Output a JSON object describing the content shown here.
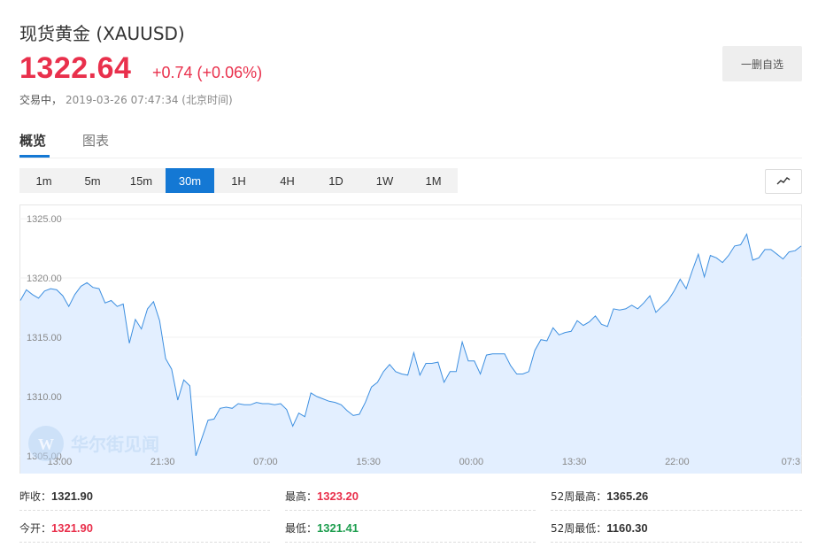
{
  "header": {
    "title": "现货黄金",
    "symbol": "(XAUUSD)",
    "price": "1322.64",
    "change": "+0.74 (+0.06%)",
    "status": "交易中，",
    "timestamp": "2019-03-26 07:47:34 (北京时间)",
    "watch_button": "一删自选"
  },
  "tabs": [
    {
      "label": "概览",
      "active": true
    },
    {
      "label": "图表",
      "active": false
    }
  ],
  "periods": [
    {
      "label": "1m"
    },
    {
      "label": "5m"
    },
    {
      "label": "15m"
    },
    {
      "label": "30m",
      "active": true
    },
    {
      "label": "1H"
    },
    {
      "label": "4H"
    },
    {
      "label": "1D"
    },
    {
      "label": "1W"
    },
    {
      "label": "1M"
    }
  ],
  "chart_type_icon": "line-chart-icon",
  "watermark": "华尔街见闻",
  "colors": {
    "up": "#e9304c",
    "down": "#1e9e4f",
    "accent": "#1478d4",
    "line": "#3d8fe0",
    "area": "#e3efff"
  },
  "chart_data": {
    "type": "area",
    "ylim": [
      1303.5,
      1326.2
    ],
    "yticks": [
      "1325.00",
      "1320.00",
      "1315.00",
      "1310.00",
      "1305.00"
    ],
    "ytick_values": [
      1325,
      1320,
      1315,
      1310,
      1305
    ],
    "xtick_labels": [
      "13:00",
      "21:30",
      "07:00",
      "15:30",
      "00:00",
      "13:30",
      "22:00",
      "07:3"
    ],
    "xtick_index": [
      6.5,
      23.5,
      40.5,
      57.5,
      74.5,
      91.5,
      108.5,
      125.5
    ],
    "values": [
      1318.1,
      1319.0,
      1318.6,
      1318.3,
      1318.9,
      1319.1,
      1319.0,
      1318.5,
      1317.6,
      1318.6,
      1319.3,
      1319.6,
      1319.2,
      1319.1,
      1317.9,
      1318.1,
      1317.6,
      1317.8,
      1314.5,
      1316.5,
      1315.7,
      1317.4,
      1318.0,
      1316.4,
      1313.2,
      1312.3,
      1309.7,
      1311.4,
      1310.9,
      1305.0,
      1306.5,
      1308.0,
      1308.1,
      1309.0,
      1309.1,
      1309.0,
      1309.4,
      1309.3,
      1309.3,
      1309.5,
      1309.4,
      1309.4,
      1309.3,
      1309.4,
      1308.9,
      1307.5,
      1308.6,
      1308.3,
      1310.3,
      1310.0,
      1309.8,
      1309.6,
      1309.5,
      1309.3,
      1308.8,
      1308.4,
      1308.5,
      1309.5,
      1310.8,
      1311.2,
      1312.1,
      1312.7,
      1312.1,
      1311.9,
      1311.8,
      1313.7,
      1311.8,
      1312.8,
      1312.8,
      1312.9,
      1311.2,
      1312.1,
      1312.1,
      1314.6,
      1313.0,
      1313.0,
      1311.9,
      1313.5,
      1313.6,
      1313.6,
      1313.6,
      1312.6,
      1311.9,
      1311.9,
      1312.1,
      1313.9,
      1314.8,
      1314.7,
      1315.8,
      1315.2,
      1315.4,
      1315.5,
      1316.4,
      1316.0,
      1316.3,
      1316.8,
      1316.1,
      1315.9,
      1317.4,
      1317.3,
      1317.4,
      1317.7,
      1317.4,
      1317.9,
      1318.5,
      1317.1,
      1317.6,
      1318.1,
      1318.9,
      1319.9,
      1319.1,
      1320.6,
      1322.0,
      1320.1,
      1321.9,
      1321.7,
      1321.3,
      1321.9,
      1322.7,
      1322.8,
      1323.7,
      1321.5,
      1321.7,
      1322.4,
      1322.4,
      1322.0,
      1321.6,
      1322.2,
      1322.3,
      1322.7
    ]
  },
  "stats": [
    {
      "label": "昨收：",
      "value": "1321.90",
      "tone": "black"
    },
    {
      "label": "最高：",
      "value": "1323.20",
      "tone": "red"
    },
    {
      "label": "52周最高：",
      "value": "1365.26",
      "tone": "black"
    },
    {
      "label": "今开：",
      "value": "1321.90",
      "tone": "red"
    },
    {
      "label": "最低：",
      "value": "1321.41",
      "tone": "green"
    },
    {
      "label": "52周最低：",
      "value": "1160.30",
      "tone": "black"
    }
  ]
}
